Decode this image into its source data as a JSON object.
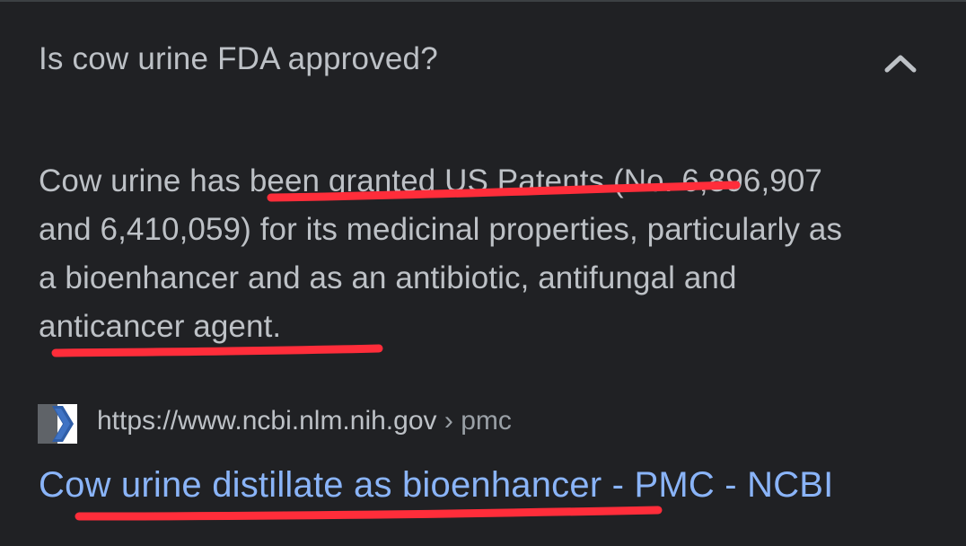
{
  "faq": {
    "question": "Is cow urine FDA approved?",
    "toggle_icon": "chevron-up-icon",
    "answer_lines": [
      "Cow urine has been granted US Patents (No. 6,896,907",
      "and 6,410,059) for its medicinal properties, particularly as",
      "a bioenhancer and as an antibiotic, antifungal and",
      "anticancer agent."
    ]
  },
  "source": {
    "favicon_icon": "ncbi-chevron-icon",
    "domain": "https://www.ncbi.nlm.nih.gov",
    "separator": "›",
    "path": "pmc"
  },
  "result": {
    "title": "Cow urine distillate as bioenhancer - PMC - NCBI"
  },
  "colors": {
    "background": "#202124",
    "text": "#bdc1c6",
    "link": "#8ab4f8",
    "annotation": "#ff2d3a"
  }
}
